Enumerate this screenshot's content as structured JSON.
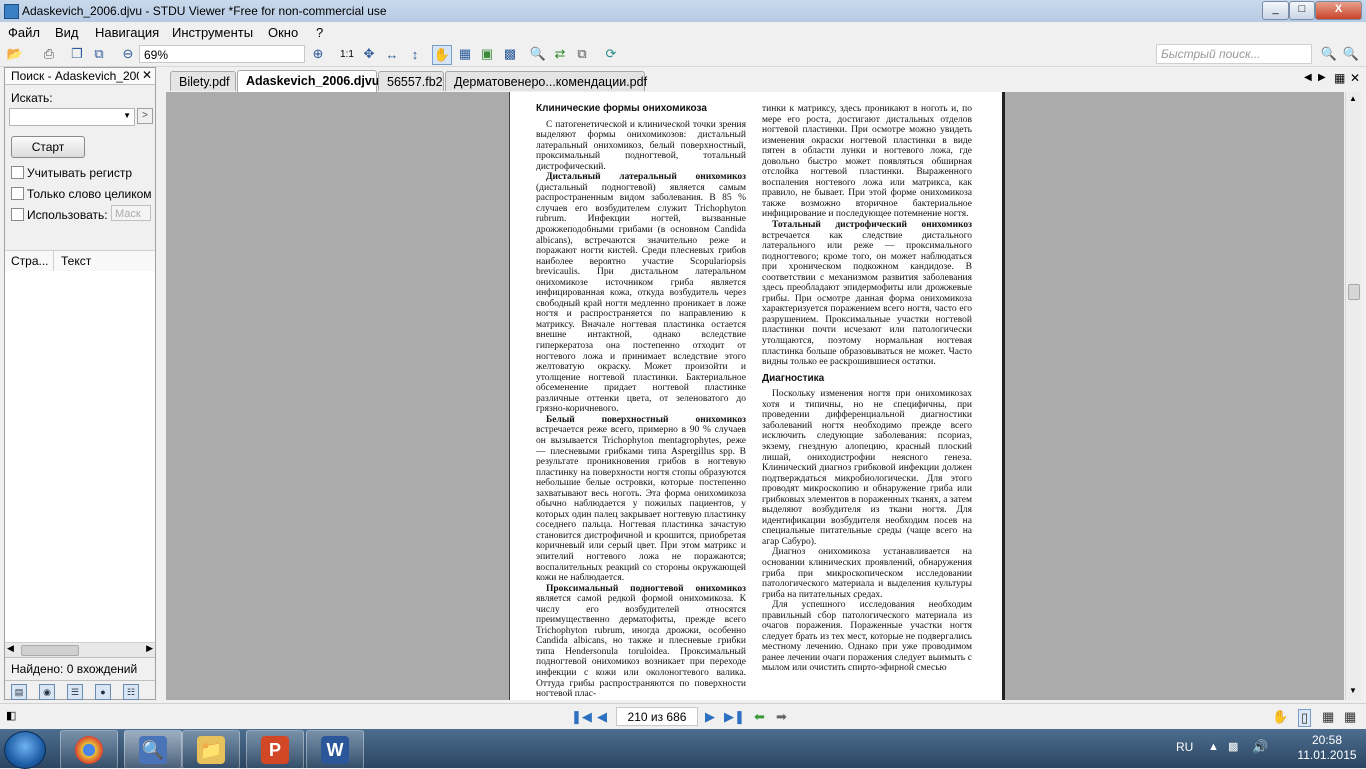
{
  "window": {
    "title": "Adaskevich_2006.djvu - STDU Viewer *Free for non-commercial use",
    "min": "_",
    "max": "□",
    "close": "X"
  },
  "menu": [
    "Файл",
    "Вид",
    "Навигация",
    "Инструменты",
    "Окно",
    "?"
  ],
  "toolbar": {
    "zoom": "69%",
    "actual_size": "1:1",
    "quick_search_placeholder": "Быстрый поиск..."
  },
  "search_panel": {
    "title": "Поиск - Adaskevich_2006.djvu",
    "find_label": "Искать:",
    "start_button": "Старт",
    "case_label": "Учитывать регистр",
    "whole_word_label": "Только слово целиком",
    "use_label": "Использовать:",
    "use_value": "Маск",
    "col_page": "Стра...",
    "col_text": "Текст",
    "found": "Найдено: 0 вхождений"
  },
  "tabs": [
    "Bilety.pdf",
    "Adaskevich_2006.djvu",
    "56557.fb2",
    "Дерматовенеро...комендации.pdf"
  ],
  "active_tab": 1,
  "status": {
    "page_indicator": "210 из 686"
  },
  "document": {
    "left_heading": "Клинические формы онихомикоза",
    "left_p1": "С патогенетической и клинической точки зрения выделяют формы онихомикозов: дистальный латеральный онихомикоз, белый поверхностный, проксимальный подногтевой, тотальный дистрофический.",
    "left_p2_bold": "Дистальный латеральный онихомикоз",
    "left_p2": " (дистальный подногтевой) является самым распространенным видом заболевания. В 85 % случаев его возбудителем служит Trichophyton rubrum. Инфекции ногтей, вызванные дрожжеподобными грибами (в основном Candida albicans), встречаются значительно реже и поражают ногти кистей. Среди плесневых грибов наиболее вероятно участие Scopulariopsis brevicaulis. При дистальном латеральном онихомикозе источником гриба является инфицированная кожа, откуда возбудитель через свободный край ногтя медленно проникает в ложе ногтя и распространяется по направлению к матриксу. Вначале ногтевая пластинка остается внешне интактной, однако вследствие гиперкератоза она постепенно отходит от ногтевого ложа и принимает вследствие этого желтоватую окраску. Может произойти и утолщение ногтевой пластинки. Бактериальное обсеменение придает ногтевой пластинке различные оттенки цвета, от зеленоватого до грязно-коричневого.",
    "left_p3_bold": "Белый поверхностный онихомикоз",
    "left_p3": " встречается реже всего, примерно в 90 % случаев он вызывается Trichophyton mentagrophytes, реже — плесневыми грибками типа Aspergillus spp. В результате проникновения грибов в ногтевую пластинку на поверхности ногтя стопы образуются небольшие белые островки, которые постепенно захватывают весь ноготь. Эта форма онихомикоза обычно наблюдается у пожилых пациентов, у которых один палец закрывает ногтевую пластинку соседнего пальца. Ногтевая пластинка зачастую становится дистрофичной и крошится, приобретая коричневый или серый цвет. При этом матрикс и эпителий ногтевого ложа не поражаются; воспалительных реакций со стороны окружающей кожи не наблюдается.",
    "left_p4_bold": "Проксимальный подногтевой онихомикоз",
    "left_p4": " является самой редкой формой онихомикоза. К числу его возбудителей относятся преимущественно дерматофиты, прежде всего Trichophyton rubrum, иногда дрожжи, особенно Candida albicans, но также и плесневые грибки типа Hendersonula toruloidea. Проксимальный подногтевой онихомикоз возникает при переходе инфекции с кожи или околоногтевого валика. Оттуда грибы распространяются по поверхности ногтевой плас-",
    "right_p1": "тинки к матриксу, здесь проникают в ноготь и, по мере его роста, достигают дистальных отделов ногтевой пластинки. При осмотре можно увидеть изменения окраски ногтевой пластинки в виде пятен в области лунки и ногтевого ложа, где довольно быстро может появляться обширная отслойка ногтевой пластинки. Выраженного воспаления ногтевого ложа или матрикса, как правило, не бывает. При этой форме онихомикоза также возможно вторичное бактериальное инфицирование и последующее потемнение ногтя.",
    "right_p2_bold": "Тотальный дистрофический онихомикоз",
    "right_p2": " встречается как следствие дистального латерального или реже — проксимального подногтевого; кроме того, он может наблюдаться при хроническом подкожном кандидозе. В соответствии с механизмом развития заболевания здесь преобладают эпидермофиты или дрожжевые грибы. При осмотре данная форма онихомикоза характеризуется поражением всего ногтя, часто его разрушением. Проксимальные участки ногтевой пластинки почти исчезают или патологически утолщаются, поэтому нормальная ногтевая пластинка больше образовываться не может. Часто видны только ее раскрошившиеся остатки.",
    "right_heading": "Диагностика",
    "right_p3": "Поскольку изменения ногтя при онихомикозах хотя и типичны, но не специфичны, при проведении дифференциальной диагностики заболеваний ногтя необходимо прежде всего исключить следующие заболевания: псориаз, экзему, гнездную алопецию, красный плоский лишай, ониходистрофии неясного генеза. Клинический диагноз грибковой инфекции должен подтверждаться микробиологически. Для этого проводят микроскопию и обнаружение гриба или грибковых элементов в пораженных тканях, а затем выделяют возбудителя из ткани ногтя. Для идентификации возбудителя необходим посев на специальные питательные среды (чаще всего на агар Сабуро).",
    "right_p4": "Диагноз онихомикоза устанавливается на основании клинических проявлений, обнаружения гриба при микроскопическом исследовании патологического материала и выделения культуры гриба на питательных средах.",
    "right_p5": "Для успешного исследования необходим правильный сбор патологического материала из очагов поражения. Пораженные участки ногтя следует брать из тех мест, которые не подвергались местному лечению. Однако при уже проводимом ранее лечении очаги поражения следует выимыть с мылом или очистить спирто-эфирной смесью"
  },
  "taskbar": {
    "lang": "RU",
    "time": "20:58",
    "date": "11.01.2015"
  },
  "icons": {
    "accent": "#2d6fc0"
  }
}
